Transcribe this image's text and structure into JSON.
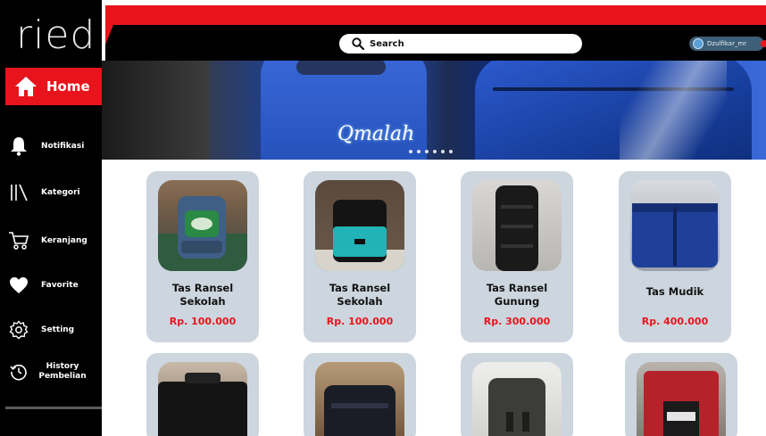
{
  "brand": {
    "logo_text": "ried",
    "banner_text": "Qmalah"
  },
  "search": {
    "label": "Search"
  },
  "user": {
    "name": "Dzulfikar_mr"
  },
  "sidebar": {
    "home": "Home",
    "items": [
      {
        "label": "Notifikasi",
        "icon": "bell-icon"
      },
      {
        "label": "Kategori",
        "icon": "category-icon"
      },
      {
        "label": "Keranjang",
        "icon": "cart-icon"
      },
      {
        "label": "Favorite",
        "icon": "heart-icon"
      },
      {
        "label": "Setting",
        "icon": "gear-icon"
      },
      {
        "label_line1": "History",
        "label_line2": "Pembelian",
        "icon": "history-icon"
      }
    ]
  },
  "products": [
    {
      "name_line1": "Tas Ransel",
      "name_line2": "Sekolah",
      "price": "Rp. 100.000"
    },
    {
      "name_line1": "Tas Ransel",
      "name_line2": "Sekolah",
      "price": "Rp. 100.000"
    },
    {
      "name_line1": "Tas Ransel",
      "name_line2": "Gunung",
      "price": "Rp. 300.000"
    },
    {
      "name_line1": "Tas Mudik",
      "name_line2": "",
      "price": "Rp. 400.000"
    }
  ],
  "colors": {
    "accent": "#e8141c",
    "sidebar": "#000000",
    "card": "#cdd6df",
    "price": "#e8141c"
  }
}
